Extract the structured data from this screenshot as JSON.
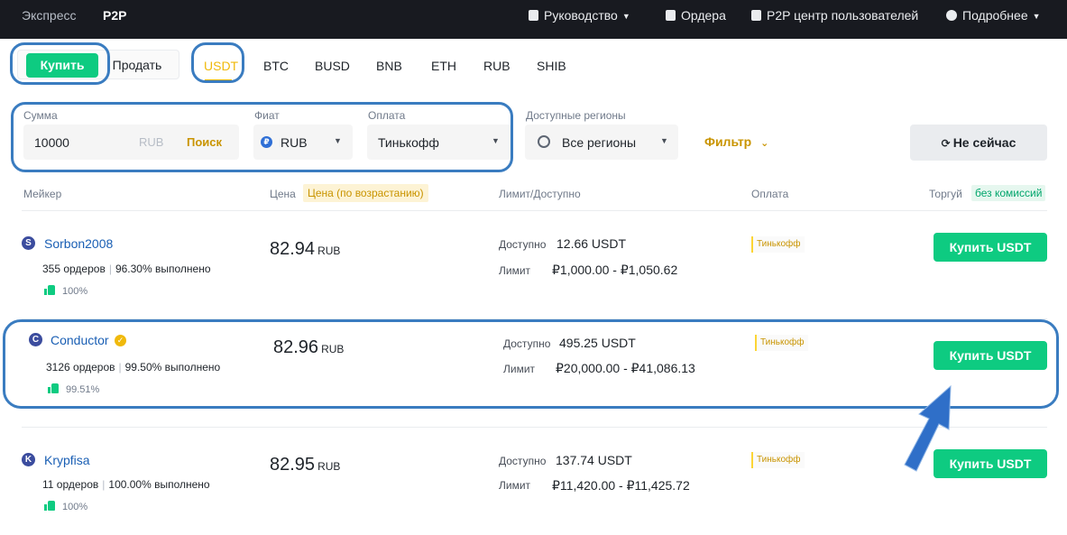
{
  "topnav": {
    "express": "Экспресс",
    "p2p": "P2P",
    "guide": "Руководство",
    "orders": "Ордера",
    "user_center": "P2P центр пользователей",
    "more": "Подробнее"
  },
  "trade_toggle": {
    "buy": "Купить",
    "sell": "Продать"
  },
  "asset_tabs": [
    "USDT",
    "BTC",
    "BUSD",
    "BNB",
    "ETH",
    "RUB",
    "SHIB"
  ],
  "filters": {
    "amount_label": "Сумма",
    "amount_value": "10000",
    "amount_currency": "RUB",
    "search": "Поиск",
    "fiat_label": "Фиат",
    "fiat_value": "RUB",
    "fiat_icon": "₽",
    "payment_label": "Оплата",
    "payment_value": "Тинькофф",
    "region_label": "Доступные регионы",
    "region_value": "Все регионы",
    "filter_button": "Фильтр",
    "refresh_button": "Не сейчас"
  },
  "table_header": {
    "maker": "Мейкер",
    "price": "Цена",
    "price_sort": "Цена (по возрастанию)",
    "limit": "Лимит/Доступно",
    "payment": "Оплата",
    "trade": "Торгуй",
    "no_fee": "без комиссий"
  },
  "offers": [
    {
      "initial": "S",
      "name": "Sorbon2008",
      "orders": "355 ордеров",
      "completion": "96.30% выполнено",
      "rating": "100%",
      "price": "82.94",
      "currency": "RUB",
      "available_label": "Доступно",
      "available": "12.66 USDT",
      "limit_label": "Лимит",
      "limit": "₽1,000.00 - ₽1,050.62",
      "payment": "Тинькофф",
      "button": "Купить USDT",
      "verified": false
    },
    {
      "initial": "C",
      "name": "Conductor",
      "orders": "3126 ордеров",
      "completion": "99.50% выполнено",
      "rating": "99.51%",
      "price": "82.96",
      "currency": "RUB",
      "available_label": "Доступно",
      "available": "495.25 USDT",
      "limit_label": "Лимит",
      "limit": "₽20,000.00 - ₽41,086.13",
      "payment": "Тинькофф",
      "button": "Купить USDT",
      "verified": true
    },
    {
      "initial": "K",
      "name": "Krypfisa",
      "orders": "11 ордеров",
      "completion": "100.00% выполнено",
      "rating": "100%",
      "price": "82.95",
      "currency": "RUB",
      "available_label": "Доступно",
      "available": "137.74 USDT",
      "limit_label": "Лимит",
      "limit": "₽11,420.00 - ₽11,425.72",
      "payment": "Тинькофф",
      "button": "Купить USDT",
      "verified": false
    }
  ],
  "colors": {
    "topbar_bg": "#181a20",
    "buy_green": "#0ecb81",
    "accent_yellow": "#f0b90b",
    "annotation_blue": "#3a7cc0"
  }
}
